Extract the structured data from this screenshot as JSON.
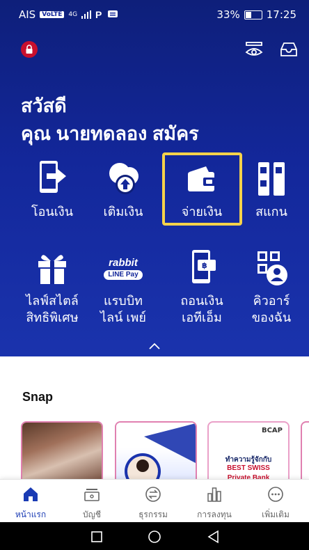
{
  "status_bar": {
    "carrier": "AIS",
    "chip": "VoLTE",
    "network": "4G",
    "battery_percent": "33%",
    "time": "17:25"
  },
  "greeting": {
    "line1": "สวัสดี",
    "line2": "คุณ นายทดลอง สมัคร"
  },
  "quick_actions": [
    {
      "label": "โอนเงิน",
      "icon": "transfer-icon"
    },
    {
      "label": "เติมเงิน",
      "icon": "topup-icon"
    },
    {
      "label": "จ่ายเงิน",
      "icon": "wallet-icon",
      "highlighted": true
    },
    {
      "label": "สแกน",
      "icon": "scan-icon"
    },
    {
      "label": "ไลฟ์สไตล์",
      "label2": "สิทธิพิเศษ",
      "icon": "gift-icon"
    },
    {
      "label": "แรบบิท",
      "label2": "ไลน์ เพย์",
      "icon": "rabbit-linepay-icon",
      "logo_top": "rabbit",
      "logo_bottom": "LINE Pay"
    },
    {
      "label": "ถอนเงิน",
      "label2": "เอทีเอ็ม",
      "icon": "atm-withdraw-icon"
    },
    {
      "label": "คิวอาร์",
      "label2": "ของฉัน",
      "icon": "my-qr-icon"
    }
  ],
  "snap": {
    "title": "Snap",
    "card3_brand": "BCAP",
    "card3_line1": "ทำความรู้จักกับ",
    "card3_line2": "BEST SWISS",
    "card3_line3": "Private Bank"
  },
  "tabs": [
    {
      "label": "หน้าแรก",
      "icon": "home-icon",
      "active": true
    },
    {
      "label": "บัญชี",
      "icon": "account-icon"
    },
    {
      "label": "ธุรกรรม",
      "icon": "transaction-icon"
    },
    {
      "label": "การลงทุน",
      "icon": "invest-icon"
    },
    {
      "label": "เพิ่มเติม",
      "icon": "more-icon"
    }
  ],
  "colors": {
    "primary": "#13279a",
    "highlight": "#f5d24a",
    "active_tab": "#1a3bb4"
  }
}
